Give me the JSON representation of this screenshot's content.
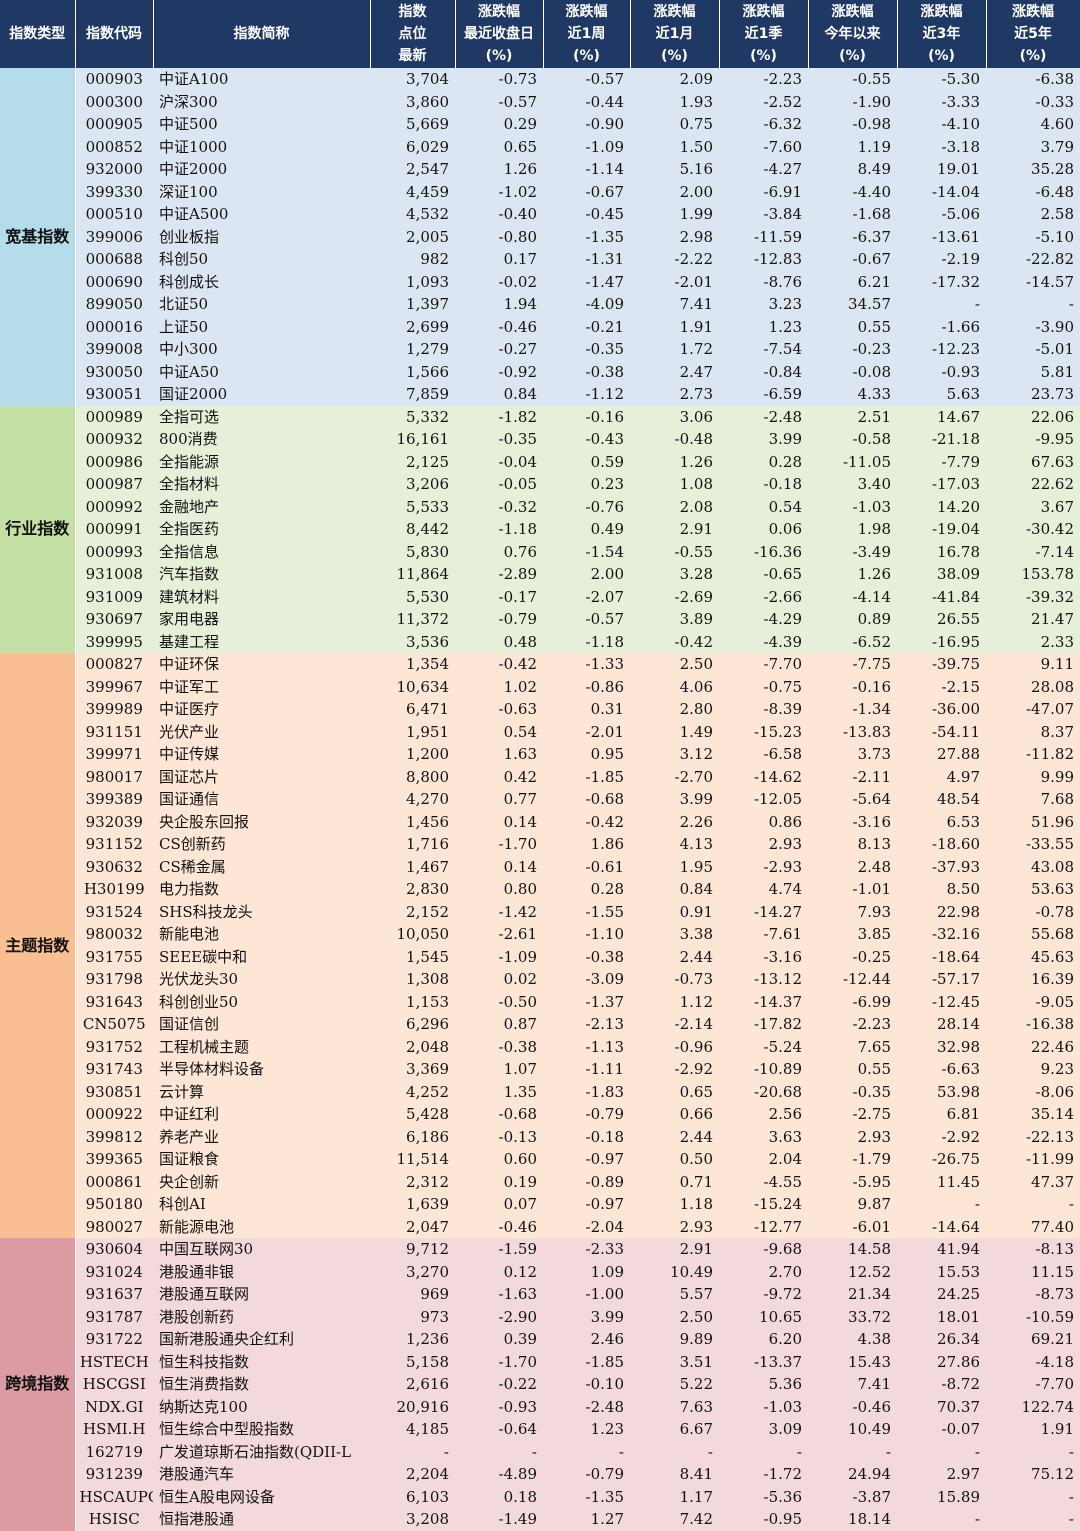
{
  "headers": [
    {
      "lines": [
        "指数类型"
      ]
    },
    {
      "lines": [
        "指数代码"
      ]
    },
    {
      "lines": [
        "指数简称"
      ]
    },
    {
      "lines": [
        "指数",
        "点位",
        "最新"
      ]
    },
    {
      "lines": [
        "涨跌幅",
        "最近收盘日",
        "(%)"
      ]
    },
    {
      "lines": [
        "涨跌幅",
        "近1周",
        "(%)"
      ]
    },
    {
      "lines": [
        "涨跌幅",
        "近1月",
        "(%)"
      ]
    },
    {
      "lines": [
        "涨跌幅",
        "近1季",
        "(%)"
      ]
    },
    {
      "lines": [
        "涨跌幅",
        "今年以来",
        "(%)"
      ]
    },
    {
      "lines": [
        "涨跌幅",
        "近3年",
        "(%)"
      ]
    },
    {
      "lines": [
        "涨跌幅",
        "近5年",
        "(%)"
      ]
    }
  ],
  "groups": [
    {
      "name": "宽基指数",
      "class": "g-wide",
      "rows": [
        [
          "000903",
          "中证A100",
          "3,704",
          "-0.73",
          "-0.57",
          "2.09",
          "-2.23",
          "-0.55",
          "-5.30",
          "-6.38"
        ],
        [
          "000300",
          "沪深300",
          "3,860",
          "-0.57",
          "-0.44",
          "1.93",
          "-2.52",
          "-1.90",
          "-3.33",
          "-0.33"
        ],
        [
          "000905",
          "中证500",
          "5,669",
          "0.29",
          "-0.90",
          "0.75",
          "-6.32",
          "-0.98",
          "-4.10",
          "4.60"
        ],
        [
          "000852",
          "中证1000",
          "6,029",
          "0.65",
          "-1.09",
          "1.50",
          "-7.60",
          "1.19",
          "-3.18",
          "3.79"
        ],
        [
          "932000",
          "中证2000",
          "2,547",
          "1.26",
          "-1.14",
          "5.16",
          "-4.27",
          "8.49",
          "19.01",
          "35.28"
        ],
        [
          "399330",
          "深证100",
          "4,459",
          "-1.02",
          "-0.67",
          "2.00",
          "-6.91",
          "-4.40",
          "-14.04",
          "-6.48"
        ],
        [
          "000510",
          "中证A500",
          "4,532",
          "-0.40",
          "-0.45",
          "1.99",
          "-3.84",
          "-1.68",
          "-5.06",
          "2.58"
        ],
        [
          "399006",
          "创业板指",
          "2,005",
          "-0.80",
          "-1.35",
          "2.98",
          "-11.59",
          "-6.37",
          "-13.61",
          "-5.10"
        ],
        [
          "000688",
          "科创50",
          "982",
          "0.17",
          "-1.31",
          "-2.22",
          "-12.83",
          "-0.67",
          "-2.19",
          "-22.82"
        ],
        [
          "000690",
          "科创成长",
          "1,093",
          "-0.02",
          "-1.47",
          "-2.01",
          "-8.76",
          "6.21",
          "-17.32",
          "-14.57"
        ],
        [
          "899050",
          "北证50",
          "1,397",
          "1.94",
          "-4.09",
          "7.41",
          "3.23",
          "34.57",
          "-",
          "-"
        ],
        [
          "000016",
          "上证50",
          "2,699",
          "-0.46",
          "-0.21",
          "1.91",
          "1.23",
          "0.55",
          "-1.66",
          "-3.90"
        ],
        [
          "399008",
          "中小300",
          "1,279",
          "-0.27",
          "-0.35",
          "1.72",
          "-7.54",
          "-0.23",
          "-12.23",
          "-5.01"
        ],
        [
          "930050",
          "中证A50",
          "1,566",
          "-0.92",
          "-0.38",
          "2.47",
          "-0.84",
          "-0.08",
          "-0.93",
          "5.81"
        ],
        [
          "930051",
          "国证2000",
          "7,859",
          "0.84",
          "-1.12",
          "2.73",
          "-6.59",
          "4.33",
          "5.63",
          "23.73"
        ]
      ]
    },
    {
      "name": "行业指数",
      "class": "g-ind",
      "rows": [
        [
          "000989",
          "全指可选",
          "5,332",
          "-1.82",
          "-0.16",
          "3.06",
          "-2.48",
          "2.51",
          "14.67",
          "22.06"
        ],
        [
          "000932",
          "800消费",
          "16,161",
          "-0.35",
          "-0.43",
          "-0.48",
          "3.99",
          "-0.58",
          "-21.18",
          "-9.95"
        ],
        [
          "000986",
          "全指能源",
          "2,125",
          "-0.04",
          "0.59",
          "1.26",
          "0.28",
          "-11.05",
          "-7.79",
          "67.63"
        ],
        [
          "000987",
          "全指材料",
          "3,206",
          "-0.05",
          "0.23",
          "1.08",
          "-0.18",
          "3.40",
          "-17.03",
          "22.62"
        ],
        [
          "000992",
          "金融地产",
          "5,533",
          "-0.32",
          "-0.76",
          "2.08",
          "0.54",
          "-1.03",
          "14.20",
          "3.67"
        ],
        [
          "000991",
          "全指医药",
          "8,442",
          "-1.18",
          "0.49",
          "2.91",
          "0.06",
          "1.98",
          "-19.04",
          "-30.42"
        ],
        [
          "000993",
          "全指信息",
          "5,830",
          "0.76",
          "-1.54",
          "-0.55",
          "-16.36",
          "-3.49",
          "16.78",
          "-7.14"
        ],
        [
          "931008",
          "汽车指数",
          "11,864",
          "-2.89",
          "2.00",
          "3.28",
          "-0.65",
          "1.26",
          "38.09",
          "153.78"
        ],
        [
          "931009",
          "建筑材料",
          "5,530",
          "-0.17",
          "-2.07",
          "-2.69",
          "-2.66",
          "-4.14",
          "-41.84",
          "-39.32"
        ],
        [
          "930697",
          "家用电器",
          "11,372",
          "-0.79",
          "-0.57",
          "3.89",
          "-4.29",
          "0.89",
          "26.55",
          "21.47"
        ],
        [
          "399995",
          "基建工程",
          "3,536",
          "0.48",
          "-1.18",
          "-0.42",
          "-4.39",
          "-6.52",
          "-16.95",
          "2.33"
        ]
      ]
    },
    {
      "name": "主题指数",
      "class": "g-theme",
      "rows": [
        [
          "000827",
          "中证环保",
          "1,354",
          "-0.42",
          "-1.33",
          "2.50",
          "-7.70",
          "-7.75",
          "-39.75",
          "9.11"
        ],
        [
          "399967",
          "中证军工",
          "10,634",
          "1.02",
          "-0.86",
          "4.06",
          "-0.75",
          "-0.16",
          "-2.15",
          "28.08"
        ],
        [
          "399989",
          "中证医疗",
          "6,471",
          "-0.63",
          "0.31",
          "2.80",
          "-8.39",
          "-1.34",
          "-36.00",
          "-47.07"
        ],
        [
          "931151",
          "光伏产业",
          "1,951",
          "0.54",
          "-2.01",
          "1.49",
          "-15.23",
          "-13.83",
          "-54.11",
          "8.37"
        ],
        [
          "399971",
          "中证传媒",
          "1,200",
          "1.63",
          "0.95",
          "3.12",
          "-6.58",
          "3.73",
          "27.88",
          "-11.82"
        ],
        [
          "980017",
          "国证芯片",
          "8,800",
          "0.42",
          "-1.85",
          "-2.70",
          "-14.62",
          "-2.11",
          "4.97",
          "9.99"
        ],
        [
          "399389",
          "国证通信",
          "4,270",
          "0.77",
          "-0.68",
          "3.99",
          "-12.05",
          "-5.64",
          "48.54",
          "7.68"
        ],
        [
          "932039",
          "央企股东回报",
          "1,456",
          "0.14",
          "-0.42",
          "2.26",
          "0.86",
          "-3.16",
          "6.53",
          "51.96"
        ],
        [
          "931152",
          "CS创新药",
          "1,716",
          "-1.70",
          "1.86",
          "4.13",
          "2.93",
          "8.13",
          "-18.60",
          "-33.55"
        ],
        [
          "930632",
          "CS稀金属",
          "1,467",
          "0.14",
          "-0.61",
          "1.95",
          "-2.93",
          "2.48",
          "-37.93",
          "43.08"
        ],
        [
          "H30199",
          "电力指数",
          "2,830",
          "0.80",
          "0.28",
          "0.84",
          "4.74",
          "-1.01",
          "8.50",
          "53.63"
        ],
        [
          "931524",
          "SHS科技龙头",
          "2,152",
          "-1.42",
          "-1.55",
          "0.91",
          "-14.27",
          "7.93",
          "22.98",
          "-0.78"
        ],
        [
          "980032",
          "新能电池",
          "10,050",
          "-2.61",
          "-1.10",
          "3.38",
          "-7.61",
          "3.85",
          "-32.16",
          "55.68"
        ],
        [
          "931755",
          "SEEE碳中和",
          "1,545",
          "-1.09",
          "-0.38",
          "2.44",
          "-3.16",
          "-0.25",
          "-18.64",
          "45.63"
        ],
        [
          "931798",
          "光伏龙头30",
          "1,308",
          "0.02",
          "-3.09",
          "-0.73",
          "-13.12",
          "-12.44",
          "-57.17",
          "16.39"
        ],
        [
          "931643",
          "科创创业50",
          "1,153",
          "-0.50",
          "-1.37",
          "1.12",
          "-14.37",
          "-6.99",
          "-12.45",
          "-9.05"
        ],
        [
          "CN5075",
          "国证信创",
          "6,296",
          "0.87",
          "-2.13",
          "-2.14",
          "-17.82",
          "-2.23",
          "28.14",
          "-16.38"
        ],
        [
          "931752",
          "工程机械主题",
          "2,048",
          "-0.38",
          "-1.13",
          "-0.96",
          "-5.24",
          "7.65",
          "32.98",
          "22.46"
        ],
        [
          "931743",
          "半导体材料设备",
          "3,369",
          "1.07",
          "-1.11",
          "-2.92",
          "-10.89",
          "0.55",
          "-6.63",
          "9.23"
        ],
        [
          "930851",
          "云计算",
          "4,252",
          "1.35",
          "-1.83",
          "0.65",
          "-20.68",
          "-0.35",
          "53.98",
          "-8.06"
        ],
        [
          "000922",
          "中证红利",
          "5,428",
          "-0.68",
          "-0.79",
          "0.66",
          "2.56",
          "-2.75",
          "6.81",
          "35.14"
        ],
        [
          "399812",
          "养老产业",
          "6,186",
          "-0.13",
          "-0.18",
          "2.44",
          "3.63",
          "2.93",
          "-2.92",
          "-22.13"
        ],
        [
          "399365",
          "国证粮食",
          "11,514",
          "0.60",
          "-0.97",
          "0.50",
          "2.04",
          "-1.79",
          "-26.75",
          "-11.99"
        ],
        [
          "000861",
          "央企创新",
          "2,312",
          "0.19",
          "-0.89",
          "0.71",
          "-4.55",
          "-5.95",
          "11.45",
          "47.37"
        ],
        [
          "950180",
          "科创AI",
          "1,639",
          "0.07",
          "-0.97",
          "1.18",
          "-15.24",
          "9.87",
          "-",
          "-"
        ],
        [
          "980027",
          "新能源电池",
          "2,047",
          "-0.46",
          "-2.04",
          "2.93",
          "-12.77",
          "-6.01",
          "-14.64",
          "77.40"
        ]
      ]
    },
    {
      "name": "跨境指数",
      "class": "g-cross",
      "rows": [
        [
          "930604",
          "中国互联网30",
          "9,712",
          "-1.59",
          "-2.33",
          "2.91",
          "-9.68",
          "14.58",
          "41.94",
          "-8.13"
        ],
        [
          "931024",
          "港股通非银",
          "3,270",
          "0.12",
          "1.09",
          "10.49",
          "2.70",
          "12.52",
          "15.53",
          "11.15"
        ],
        [
          "931637",
          "港股通互联网",
          "969",
          "-1.63",
          "-1.00",
          "5.57",
          "-9.72",
          "21.34",
          "24.25",
          "-8.73"
        ],
        [
          "931787",
          "港股创新药",
          "973",
          "-2.90",
          "3.99",
          "2.50",
          "10.65",
          "33.72",
          "18.01",
          "-10.59"
        ],
        [
          "931722",
          "国新港股通央企红利",
          "1,236",
          "0.39",
          "2.46",
          "9.89",
          "6.20",
          "4.38",
          "26.34",
          "69.21"
        ],
        [
          "HSTECH",
          "恒生科技指数",
          "5,158",
          "-1.70",
          "-1.85",
          "3.51",
          "-13.37",
          "15.43",
          "27.86",
          "-4.18"
        ],
        [
          "HSCGSI",
          "恒生消费指数",
          "2,616",
          "-0.22",
          "-0.10",
          "5.22",
          "5.36",
          "7.41",
          "-8.72",
          "-7.70"
        ],
        [
          "NDX.GI",
          "纳斯达克100",
          "20,916",
          "-0.93",
          "-2.48",
          "7.63",
          "-1.03",
          "-0.46",
          "70.37",
          "122.74"
        ],
        [
          "HSMI.H",
          "恒生综合中型股指数",
          "4,185",
          "-0.64",
          "1.23",
          "6.67",
          "3.09",
          "10.49",
          "-0.07",
          "1.91"
        ],
        [
          "162719",
          "广发道琼斯石油指数(QDII-L",
          "-",
          "-",
          "-",
          "-",
          "-",
          "-",
          "-",
          "-"
        ],
        [
          "931239",
          "港股通汽车",
          "2,204",
          "-4.89",
          "-0.79",
          "8.41",
          "-1.72",
          "24.94",
          "2.97",
          "75.12"
        ],
        [
          "HSCAUPG",
          "恒生A股电网设备",
          "6,103",
          "0.18",
          "-1.35",
          "1.17",
          "-5.36",
          "-3.87",
          "15.89",
          "-"
        ],
        [
          "HSISC",
          "恒指港股通",
          "3,208",
          "-1.49",
          "1.27",
          "7.42",
          "-0.95",
          "18.14",
          "-",
          "-"
        ]
      ]
    }
  ]
}
